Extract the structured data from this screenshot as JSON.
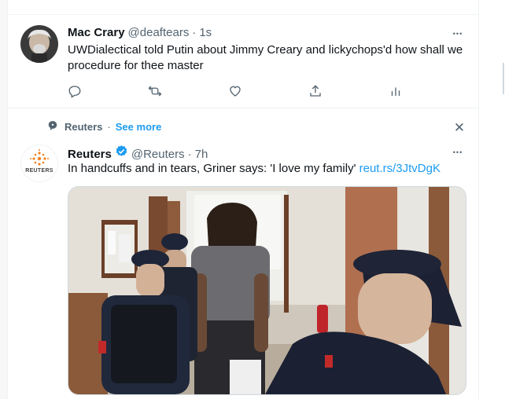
{
  "tweet1": {
    "name": "Mac Crary",
    "handle": "@deaftears",
    "dot": "·",
    "time": "1s",
    "text_line1": "UWDialectical told Putin about Jimmy Creary and lickychops'd how shall we",
    "text_line2": "procedure for thee master",
    "more_glyph": "•••"
  },
  "promo": {
    "source": "Reuters",
    "dot": "·",
    "see_more": "See more",
    "close_glyph": "✕"
  },
  "tweet2": {
    "name": "Reuters",
    "handle": "@Reuters",
    "dot": "·",
    "time": "7h",
    "text": "In handcuffs and in tears, Griner says: 'I love my family'",
    "link": "reut.rs/3JtvDgK",
    "more_glyph": "•••",
    "logo_text": "REUTERS"
  },
  "icons": {
    "reply": "reply-icon",
    "retweet": "retweet-icon",
    "like": "heart-icon",
    "share": "share-icon",
    "analytics": "analytics-icon",
    "verified": "verified-badge-icon",
    "chat": "speech-bubble-icon",
    "close": "close-icon",
    "more": "more-icon"
  },
  "colors": {
    "accent": "#1d9bf0",
    "muted": "#536471",
    "text": "#0f1419",
    "border": "#eff3f4"
  }
}
